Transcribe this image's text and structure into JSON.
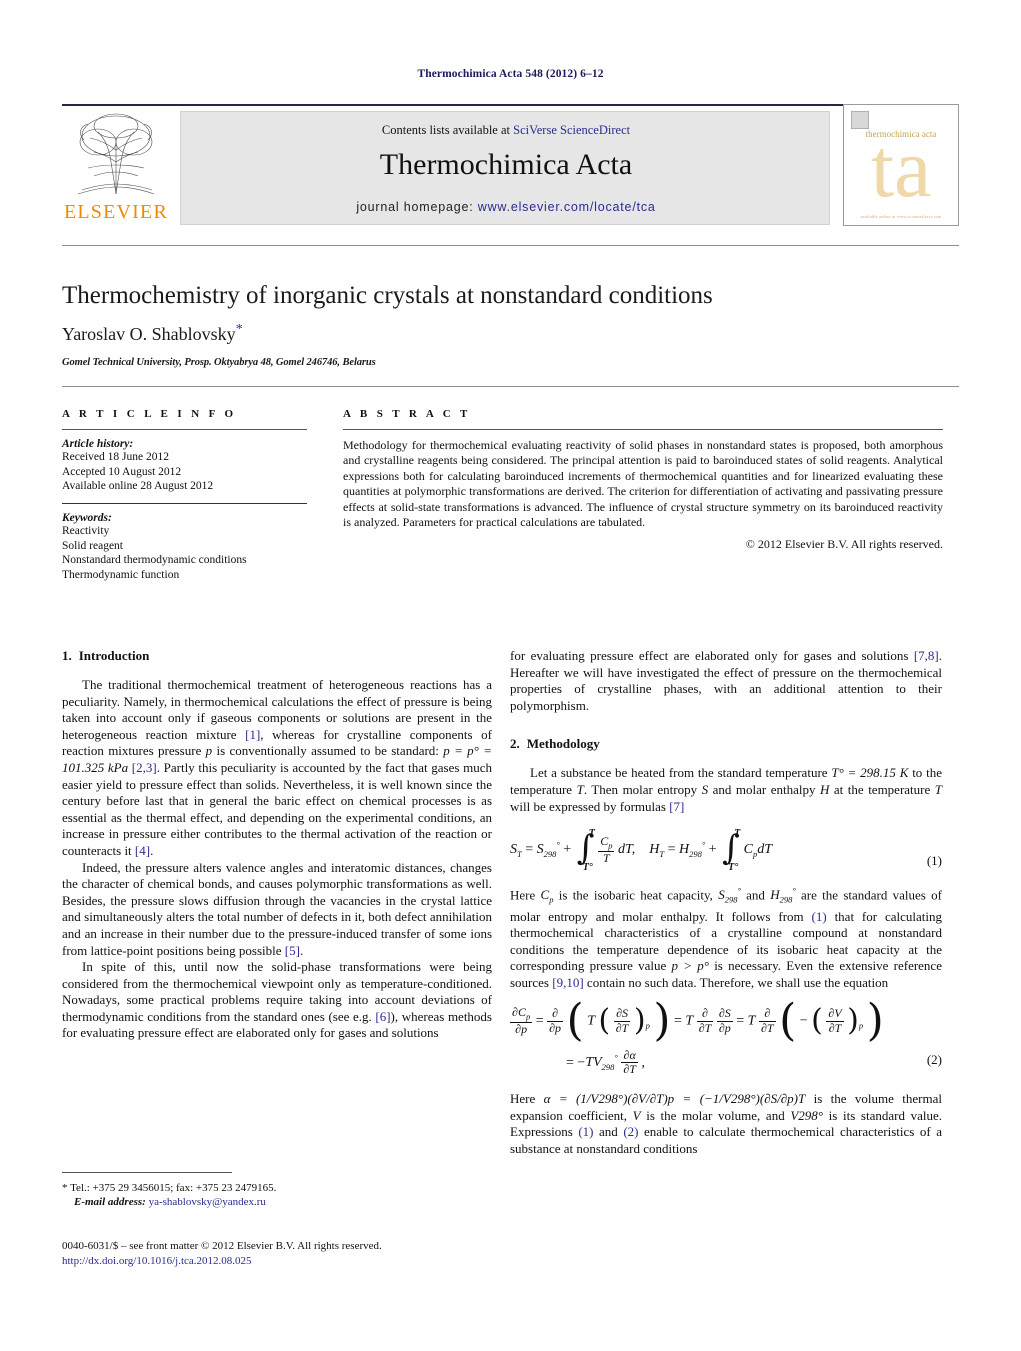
{
  "running_head": "Thermochimica Acta 548 (2012) 6–12",
  "masthead": {
    "contents_prefix": "Contents lists available at ",
    "contents_link": "SciVerse ScienceDirect",
    "journal_title": "Thermochimica Acta",
    "homepage_prefix": "journal homepage: ",
    "homepage_url": "www.elsevier.com/locate/tca",
    "publisher_logo_text": "ELSEVIER",
    "cover": {
      "journal_name": "thermochimica acta",
      "glyph": "ta",
      "footer_text": "available online at www.sciencedirect.com"
    }
  },
  "article": {
    "title": "Thermochemistry of inorganic crystals at nonstandard conditions",
    "author": "Yaroslav O. Shablovsky",
    "author_marker": "*",
    "affiliation": "Gomel Technical University, Prosp. Oktyabrya 48, Gomel 246746, Belarus"
  },
  "article_info": {
    "heading": "A R T I C L E   I N F O",
    "history_label": "Article history:",
    "history": [
      "Received 18 June 2012",
      "Accepted 10 August 2012",
      "Available online 28 August 2012"
    ],
    "keywords_label": "Keywords:",
    "keywords": [
      "Reactivity",
      "Solid reagent",
      "Nonstandard thermodynamic conditions",
      "Thermodynamic function"
    ]
  },
  "abstract": {
    "heading": "A B S T R A C T",
    "text": "Methodology for thermochemical evaluating reactivity of solid phases in nonstandard states is proposed, both amorphous and crystalline reagents being considered. The principal attention is paid to baroinduced states of solid reagents. Analytical expressions both for calculating baroinduced increments of thermochemical quantities and for linearized evaluating these quantities at polymorphic transformations are derived. The criterion for differentiation of activating and passivating pressure effects at solid-state transformations is advanced. The influence of crystal structure symmetry on its baroinduced reactivity is analyzed. Parameters for practical calculations are tabulated.",
    "copyright": "© 2012 Elsevier B.V. All rights reserved."
  },
  "sections": {
    "introduction": {
      "number": "1.",
      "title": "Introduction",
      "p1_a": "The traditional thermochemical treatment of heterogeneous reactions has a peculiarity. Namely, in thermochemical calculations the effect of pressure is being taken into account only if gaseous components or solutions are present in the heterogeneous reaction mixture ",
      "p1_ref1": "[1]",
      "p1_b": ", whereas for crystalline components of reaction mixtures pressure ",
      "p1_p": "p",
      "p1_c": " is conventionally assumed to be standard: ",
      "p1_eq": "p = p° = 101.325 kPa ",
      "p1_ref2": "[2,3]",
      "p1_d": ". Partly this peculiarity is accounted by the fact that gases much easier yield to pressure effect than solids. Nevertheless, it is well known since the century before last that in general the baric effect on chemical processes is as essential as the thermal effect, and depending on the experimental conditions, an increase in pressure either contributes to the thermal activation of the reaction or counteracts it ",
      "p1_ref3": "[4]",
      "p1_e": ".",
      "p2_a": "Indeed, the pressure alters valence angles and interatomic distances, changes the character of chemical bonds, and causes polymorphic transformations as well. Besides, the pressure slows diffusion through the vacancies in the crystal lattice and simultaneously alters the total number of defects in it, both defect annihilation and an increase in their number due to the pressure-induced transfer of some ions from lattice-point positions being possible ",
      "p2_ref": "[5]",
      "p2_b": ".",
      "p3_a": "In spite of this, until now the solid-phase transformations were being considered from the thermochemical viewpoint only as temperature-conditioned. Nowadays, some practical problems require taking into account deviations of thermodynamic conditions from the standard ones (see e.g. ",
      "p3_ref": "[6]",
      "p3_b": "), whereas methods for evaluating pressure effect are elaborated only for gases and solutions ",
      "p3_ref2": "[7,8]",
      "p3_c": ". Hereafter we will have investigated the effect of pressure on the thermochemical properties of crystalline phases, with an additional attention to their polymorphism."
    },
    "methodology": {
      "number": "2.",
      "title": "Methodology",
      "p1_a": "Let a substance be heated from the standard temperature ",
      "p1_t0": "T° = 298.15 K",
      "p1_b": " to the temperature ",
      "p1_T": "T",
      "p1_c": ". Then molar entropy ",
      "p1_S": "S",
      "p1_d": " and molar enthalpy ",
      "p1_H": "H",
      "p1_e": " at the temperature ",
      "p1_T2": "T",
      "p1_f": " will be expressed by formulas ",
      "p1_ref": "[7]",
      "p2_a": "Here ",
      "p2_cp": "C",
      "p2_cp_sub": "p",
      "p2_b": " is the isobaric heat capacity, ",
      "p2_s298": "S",
      "p2_s298_sub": "298",
      "p2_s298_sup": "°",
      "p2_c": " and ",
      "p2_h298": "H",
      "p2_h298_sub": "298",
      "p2_h298_sup": "°",
      "p2_d": " are the standard values of molar entropy and molar enthalpy. It follows from ",
      "p2_eq1": "(1)",
      "p2_e": " that for calculating thermochemical characteristics of a crystalline compound at nonstandard conditions the temperature dependence of its isobaric heat capacity at the corresponding pressure value ",
      "p2_pgt": "p > p°",
      "p2_f": " is necessary. Even the extensive reference sources ",
      "p2_ref": "[9,10]",
      "p2_g": " contain no such data. Therefore, we shall use the equation",
      "p3_a": "Here ",
      "p3_alpha": "α = (1/V298°)(∂V/∂T)p = (−1/V298°)(∂S/∂p)T",
      "p3_b": " is the volume thermal expansion coefficient, ",
      "p3_V": "V",
      "p3_c": " is the molar volume, and ",
      "p3_V298": "V298°",
      "p3_d": " is its standard value. Expressions ",
      "p3_eq1": "(1)",
      "p3_e": " and ",
      "p3_eq2": "(2)",
      "p3_f": " enable to calculate thermochemical characteristics of a substance at nonstandard conditions"
    }
  },
  "equations": {
    "eq1": {
      "number": "(1)",
      "lhs1": "S",
      "lhs1_sub": "T",
      "eq_sign": "=",
      "rhs1": "S",
      "rhs1_sub": "298",
      "rhs1_sup": "°",
      "plus": "+",
      "int_upper": "T",
      "int_lower": "T°",
      "frac_num": "C",
      "frac_num_sub": "p",
      "frac_den": "T",
      "d_t": "dT,",
      "lhs2": "H",
      "lhs2_sub": "T",
      "rhs2": "H",
      "rhs2_sub": "298",
      "rhs2_sup": "°",
      "integrand2": "C",
      "integrand2_sub": "p",
      "integrand2_d": "dT"
    },
    "eq2": {
      "number": "(2)",
      "line1": "∂Cp/∂p = ∂/∂p ( T ( ∂S/∂T )p ) = T ∂/∂T ∂S/∂p = T ∂/∂T ( − ( ∂V/∂T )p )",
      "line2": "= −TV298° ∂α/∂T ,"
    }
  },
  "footnote": {
    "marker": "*",
    "tel": "Tel.: +375 29 3456015; fax: +375 23 2479165.",
    "email_label": "E-mail address:",
    "email": "ya-shablovsky@yandex.ru"
  },
  "footer": {
    "issn_line": "0040-6031/$ – see front matter © 2012 Elsevier B.V. All rights reserved.",
    "doi": "http://dx.doi.org/10.1016/j.tca.2012.08.025"
  }
}
